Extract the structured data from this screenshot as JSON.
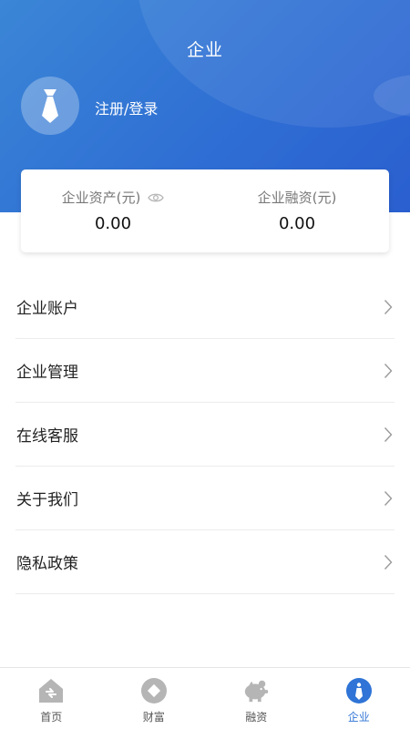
{
  "header": {
    "title": "企业",
    "login_text": "注册/登录"
  },
  "assets": {
    "company_assets_label": "企业资产(元)",
    "company_assets_value": "0.00",
    "company_financing_label": "企业融资(元)",
    "company_financing_value": "0.00"
  },
  "menu": {
    "items": [
      {
        "label": "企业账户"
      },
      {
        "label": "企业管理"
      },
      {
        "label": "在线客服"
      },
      {
        "label": "关于我们"
      },
      {
        "label": "隐私政策"
      }
    ]
  },
  "tabbar": {
    "items": [
      {
        "label": "首页",
        "icon": "home-icon"
      },
      {
        "label": "财富",
        "icon": "wealth-icon"
      },
      {
        "label": "融资",
        "icon": "piggy-bank-icon"
      },
      {
        "label": "企业",
        "icon": "enterprise-icon",
        "active": true
      }
    ]
  },
  "colors": {
    "header_blue": "#2f6fd4",
    "active_tab": "#2f74d6",
    "inactive_icon": "#b5b5b5"
  }
}
